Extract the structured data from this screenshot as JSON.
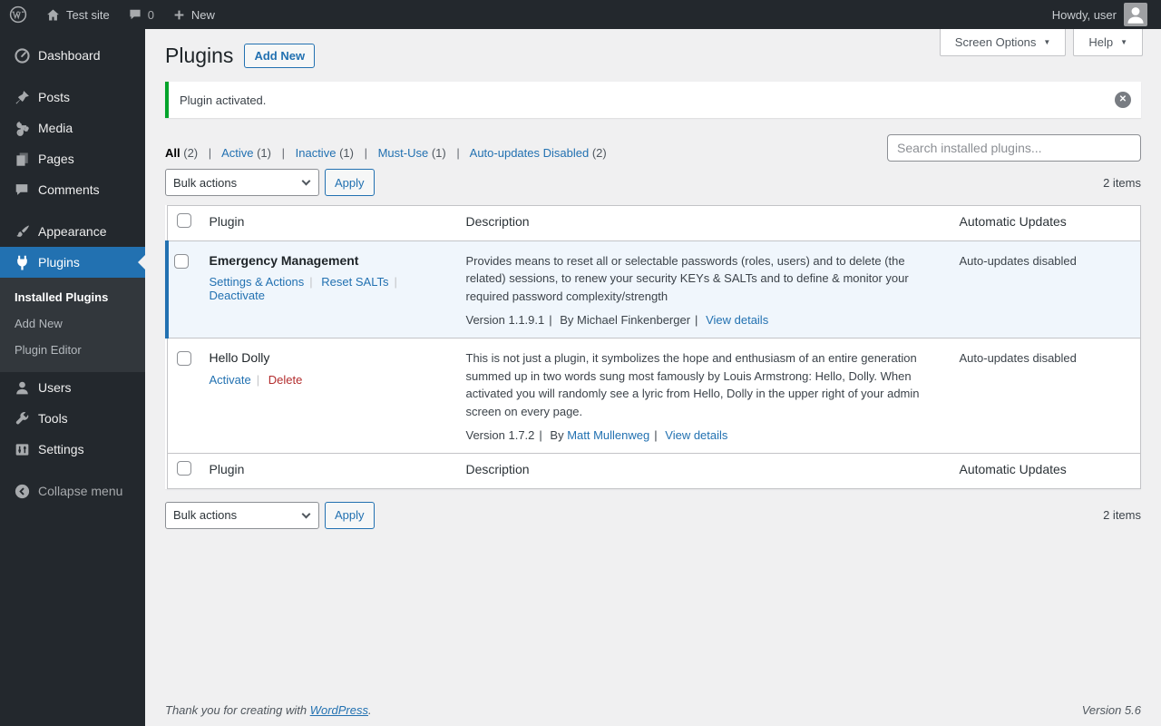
{
  "icons": {
    "dropdown_arrow": "▼",
    "dismiss_x": "✕"
  },
  "admin_bar": {
    "site_name": "Test site",
    "comment_count": "0",
    "new_label": "New",
    "howdy_label": "Howdy, user"
  },
  "sidebar": {
    "dashboard": "Dashboard",
    "posts": "Posts",
    "media": "Media",
    "pages": "Pages",
    "comments": "Comments",
    "appearance": "Appearance",
    "plugins": "Plugins",
    "submenu": {
      "installed_plugins": "Installed Plugins",
      "add_new": "Add New",
      "plugin_editor": "Plugin Editor"
    },
    "users": "Users",
    "tools": "Tools",
    "settings": "Settings",
    "collapse": "Collapse menu"
  },
  "header": {
    "title": "Plugins",
    "add_new": "Add New",
    "screen_options": "Screen Options",
    "help": "Help"
  },
  "notice": {
    "message": "Plugin activated."
  },
  "filters": {
    "all": "All",
    "all_count": "(2)",
    "active": "Active",
    "active_count": "(1)",
    "inactive": "Inactive",
    "inactive_count": "(1)",
    "must_use": "Must-Use",
    "must_use_count": "(1)",
    "auto_disabled": "Auto-updates Disabled",
    "auto_disabled_count": "(2)"
  },
  "search": {
    "placeholder": "Search installed plugins..."
  },
  "tablenav": {
    "bulk_actions": "Bulk actions",
    "apply": "Apply",
    "items_count": "2 items"
  },
  "table": {
    "col_plugin": "Plugin",
    "col_description": "Description",
    "col_auto_updates": "Automatic Updates",
    "rows": [
      {
        "name": "Emergency Management",
        "action_settings": "Settings & Actions",
        "action_reset": "Reset SALTs",
        "action_deactivate": "Deactivate",
        "description": "Provides means to reset all or selectable passwords (roles, users) and to delete (the related) sessions, to renew your security KEYs & SALTs and to define & monitor your required password complexity/strength",
        "version": "Version 1.1.9.1",
        "author": "By Michael Finkenberger",
        "view_details": "View details",
        "auto_updates": "Auto-updates disabled"
      },
      {
        "name": "Hello Dolly",
        "action_activate": "Activate",
        "action_delete": "Delete",
        "description": "This is not just a plugin, it symbolizes the hope and enthusiasm of an entire generation summed up in two words sung most famously by Louis Armstrong: Hello, Dolly. When activated you will randomly see a lyric from Hello, Dolly in the upper right of your admin screen on every page.",
        "version": "Version 1.7.2",
        "author_prefix": "By",
        "author_link": "Matt Mullenweg",
        "view_details": "View details",
        "auto_updates": "Auto-updates disabled"
      }
    ]
  },
  "footer": {
    "thanks": "Thank you for creating with",
    "wordpress": "WordPress",
    "suffix": ".",
    "version": "Version 5.6"
  }
}
